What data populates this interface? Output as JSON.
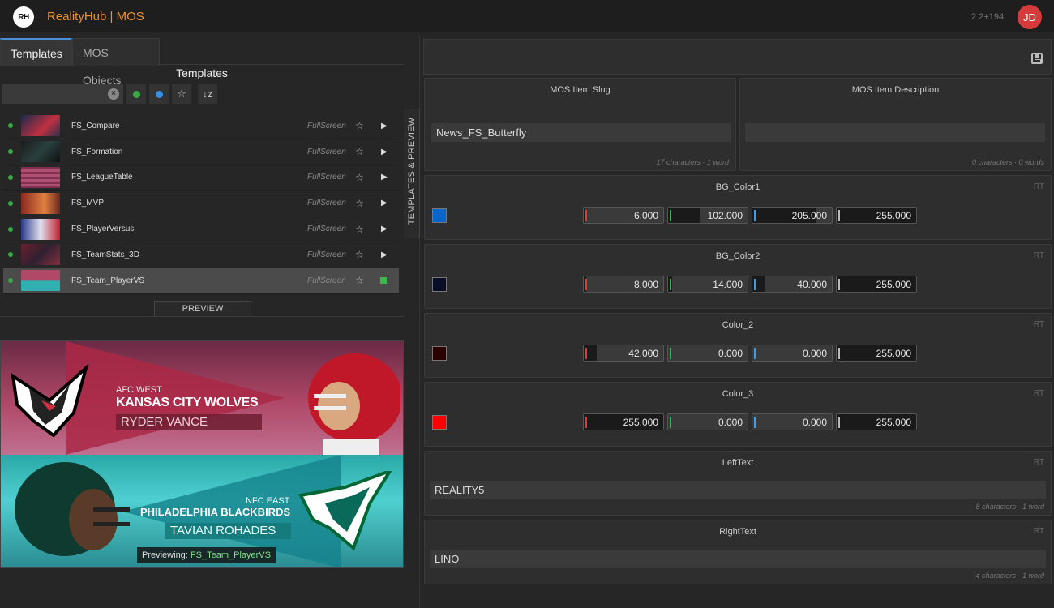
{
  "header": {
    "logo_text": "RH",
    "title": "RealityHub | MOS",
    "version": "2.2+194",
    "avatar_initials": "JD"
  },
  "left_panel": {
    "tabs": [
      {
        "label": "Templates",
        "active": true
      },
      {
        "label": "MOS Objects",
        "active": false
      }
    ],
    "section_title": "Templates",
    "search": {
      "value": "",
      "placeholder": ""
    },
    "filter_colors": {
      "green": "#3aa845",
      "blue": "#3a8ee0"
    },
    "templates": [
      {
        "name": "FS_Compare",
        "type": "FullScreen",
        "selected": false
      },
      {
        "name": "FS_Formation",
        "type": "FullScreen",
        "selected": false
      },
      {
        "name": "FS_LeagueTable",
        "type": "FullScreen",
        "selected": false
      },
      {
        "name": "FS_MVP",
        "type": "FullScreen",
        "selected": false
      },
      {
        "name": "FS_PlayerVersus",
        "type": "FullScreen",
        "selected": false
      },
      {
        "name": "FS_TeamStats_3D",
        "type": "FullScreen",
        "selected": false
      },
      {
        "name": "FS_Team_PlayerVS",
        "type": "FullScreen",
        "selected": true
      }
    ],
    "preview_tab": "PREVIEW",
    "preview": {
      "conf1": "AFC WEST",
      "team1": "KANSAS CITY WOLVES",
      "player1": "RYDER VANCE",
      "conf2": "NFC EAST",
      "team2": "PHILADELPHIA BLACKBIRDS",
      "player2": "TAVIAN ROHADES",
      "status_prefix": "Previewing:",
      "status_name": "FS_Team_PlayerVS"
    }
  },
  "vertical_tab": "TEMPLATES & PREVIEW",
  "right_panel": {
    "slug": {
      "title": "MOS Item Slug",
      "value": "News_FS_Butterfly",
      "counter": "17 characters · 1 word"
    },
    "description": {
      "title": "MOS Item Description",
      "value": "",
      "counter": "0 characters · 0 words"
    },
    "rt_label": "RT",
    "colors": [
      {
        "title": "BG_Color1",
        "swatch": "#0666cd",
        "channels": [
          "6.000",
          "102.000",
          "205.000",
          "255.000"
        ],
        "levels": [
          0.024,
          0.4,
          0.804,
          1
        ]
      },
      {
        "title": "BG_Color2",
        "swatch": "#080e28",
        "channels": [
          "8.000",
          "14.000",
          "40.000",
          "255.000"
        ],
        "levels": [
          0.031,
          0.055,
          0.157,
          1
        ]
      },
      {
        "title": "Color_2",
        "swatch": "#2a0000",
        "channels": [
          "42.000",
          "0.000",
          "0.000",
          "255.000"
        ],
        "levels": [
          0.165,
          0,
          0,
          1
        ]
      },
      {
        "title": "Color_3",
        "swatch": "#ff0000",
        "channels": [
          "255.000",
          "0.000",
          "0.000",
          "255.000"
        ],
        "levels": [
          1,
          0,
          0,
          1
        ]
      }
    ],
    "left_text": {
      "title": "LeftText",
      "value": "REALITY5",
      "counter": "8 characters · 1 word"
    },
    "right_text": {
      "title": "RightText",
      "value": "LINO",
      "counter": "4 characters · 1 word"
    }
  }
}
